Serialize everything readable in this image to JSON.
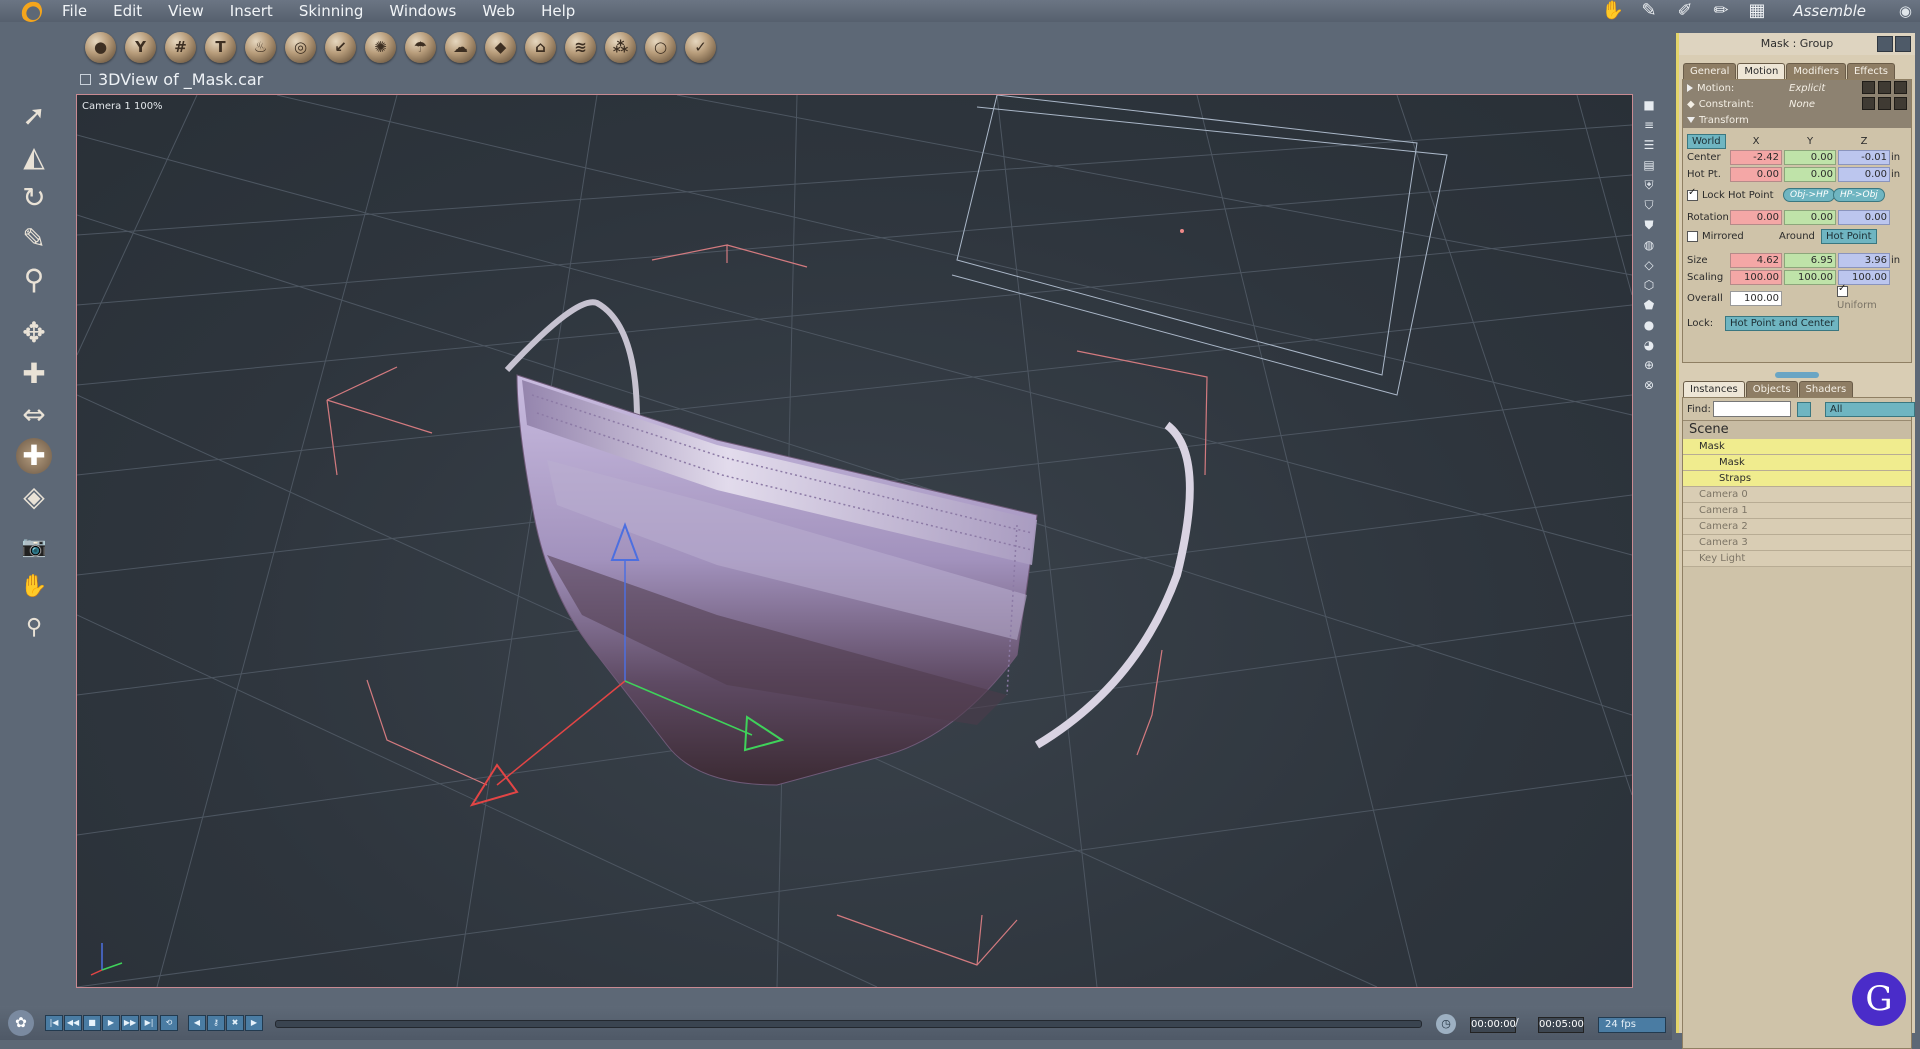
{
  "menubar": {
    "items": [
      "File",
      "Edit",
      "View",
      "Insert",
      "Skinning",
      "Windows",
      "Web",
      "Help"
    ],
    "room": "Assemble"
  },
  "viewport": {
    "title": "3DView of _Mask.car",
    "camera_label": "Camera 1 100%"
  },
  "panel": {
    "title": "Mask : Group",
    "tabs": [
      "General",
      "Motion",
      "Modifiers",
      "Effects"
    ],
    "motion_label": "Motion:",
    "motion_value": "Explicit",
    "constraint_label": "Constraint:",
    "constraint_value": "None",
    "transform_label": "Transform",
    "coord_space": "World",
    "axes": [
      "X",
      "Y",
      "Z"
    ],
    "center_label": "Center",
    "center": [
      "-2.42",
      "0.00",
      "-0.01"
    ],
    "hotpt_label": "Hot Pt.",
    "hotpt": [
      "0.00",
      "0.00",
      "0.00"
    ],
    "unit": "in",
    "lock_hot_point": "Lock Hot Point",
    "obj_hp": "Obj->HP",
    "hp_obj": "HP->Obj",
    "rotation_label": "Rotation",
    "rotation": [
      "0.00",
      "0.00",
      "0.00"
    ],
    "mirrored_label": "Mirrored",
    "around_label": "Around",
    "around_value": "Hot Point",
    "size_label": "Size",
    "size": [
      "4.62",
      "6.95",
      "3.96"
    ],
    "scaling_label": "Scaling",
    "scaling": [
      "100.00",
      "100.00",
      "100.00"
    ],
    "overall_label": "Overall",
    "overall": "100.00",
    "uniform_label": "Uniform",
    "lock_label": "Lock:",
    "lock_value": "Hot Point and Center"
  },
  "scene": {
    "tabs": [
      "Instances",
      "Objects",
      "Shaders"
    ],
    "find_label": "Find:",
    "find_value": "",
    "filter": "All",
    "root": "Scene",
    "items": [
      "Mask",
      "Mask",
      "Straps",
      "Camera 0",
      "Camera 1",
      "Camera 2",
      "Camera 3",
      "Key Light"
    ]
  },
  "timeline": {
    "current_time": "00:00:00",
    "separator": "/",
    "end_time": "00:05:00",
    "fps": "24 fps"
  },
  "colors": {
    "accent_teal": "#6fb5c1",
    "panel_bg": "#d9cdb4",
    "highlight": "#f0ec8e",
    "mask_lavender": "#b8a9cf"
  }
}
